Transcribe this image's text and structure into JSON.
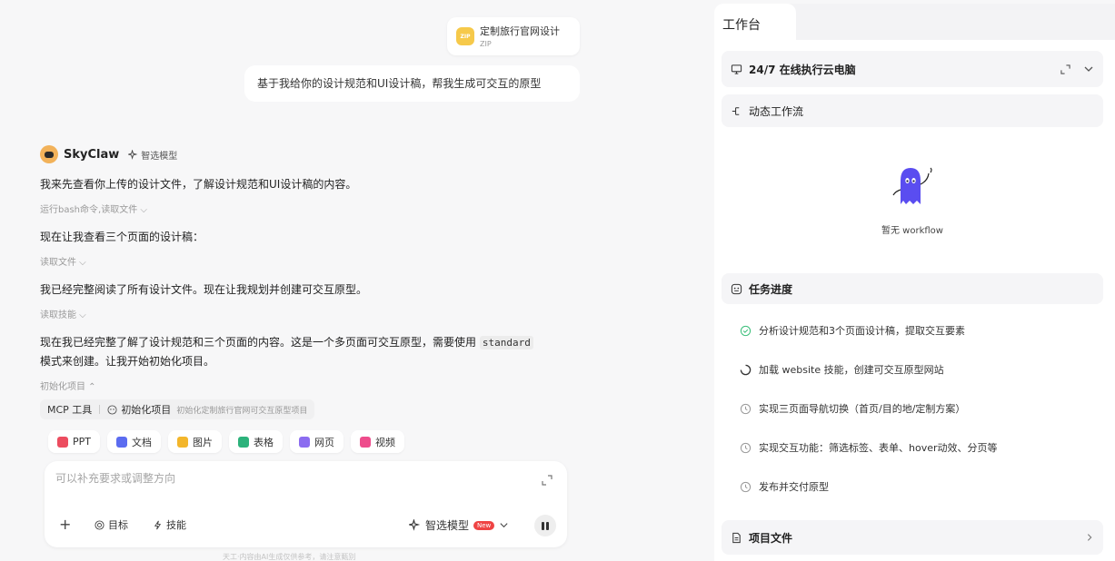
{
  "chat": {
    "attachment": {
      "name": "定制旅行官网设计",
      "type": "ZIP",
      "icon": "zip-file-icon",
      "icon_label": "ZIP"
    },
    "user_message": "基于我给你的设计规范和UI设计稿，帮我生成可交互的原型",
    "assistant": {
      "name": "SkyClaw",
      "model_label": "智选模型"
    },
    "messages": [
      {
        "text": "我来先查看你上传的设计文件，了解设计规范和UI设计稿的内容。",
        "step": "运行bash命令,读取文件 ⌵"
      },
      {
        "text": "现在让我查看三个页面的设计稿：",
        "step": "读取文件 ⌵"
      },
      {
        "text": "我已经完整阅读了所有设计文件。现在让我规划并创建可交互原型。",
        "step": "读取技能 ⌵"
      }
    ],
    "last_message": {
      "line1_pre": "现在我已经完整了解了设计规范和三个页面的内容。这是一个多页面可交互原型，需要使用",
      "code": "standard",
      "line2": "模式来创建。让我开始初始化项目。",
      "step": "初始化项目 ⌃"
    },
    "tool_call": {
      "tool": "MCP 工具",
      "action": "初始化项目",
      "detail": "初始化定制旅行官网可交互原型项目"
    },
    "quick_chips": [
      {
        "label": "PPT",
        "color": "#ec4c5f"
      },
      {
        "label": "文档",
        "color": "#5b6cf0"
      },
      {
        "label": "图片",
        "color": "#f3b62b"
      },
      {
        "label": "表格",
        "color": "#2cb27b"
      },
      {
        "label": "网页",
        "color": "#8b6cf0"
      },
      {
        "label": "视频",
        "color": "#ee4c8c"
      }
    ],
    "composer": {
      "placeholder": "可以补充要求或调整方向",
      "goal_label": "目标",
      "skill_label": "技能",
      "model_label": "智选模型",
      "new_badge": "New"
    },
    "footnote": "天工·内容由AI生成仅供参考，请注意甄别"
  },
  "workbench": {
    "title": "工作台",
    "cloud_pc": "24/7 在线执行云电脑",
    "workflow_title": "动态工作流",
    "workflow_empty": "暂无 workflow",
    "progress_title": "任务进度",
    "tasks": [
      {
        "label": "分析设计规范和3个页面设计稿，提取交互要素",
        "status": "done"
      },
      {
        "label": "加载 website 技能，创建可交互原型网站",
        "status": "running"
      },
      {
        "label": "实现三页面导航切换（首页/目的地/定制方案）",
        "status": "pending"
      },
      {
        "label": "实现交互功能：筛选标签、表单、hover动效、分页等",
        "status": "pending"
      },
      {
        "label": "发布并交付原型",
        "status": "pending"
      }
    ],
    "files_title": "项目文件"
  }
}
